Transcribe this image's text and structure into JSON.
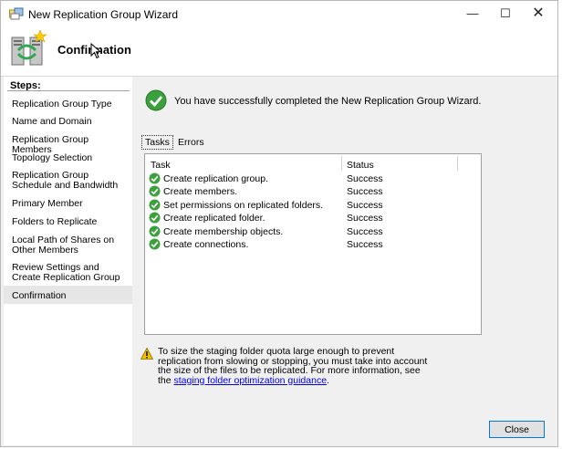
{
  "window": {
    "title": "New Replication Group Wizard",
    "controls": {
      "minimize": "—",
      "maximize": "☐",
      "close": "✕"
    }
  },
  "header": {
    "title": "Confirmation"
  },
  "steps": {
    "title": "Steps:",
    "items": [
      "Replication Group Type",
      "Name and Domain",
      "Replication Group Members",
      "Topology Selection",
      "Replication Group Schedule and Bandwidth",
      "Primary Member",
      "Folders to Replicate",
      "Local Path of Shares on Other Members",
      "Review Settings and Create Replication Group",
      "Confirmation"
    ],
    "active_index": 9
  },
  "main": {
    "success_message": "You have successfully completed the New Replication Group Wizard.",
    "tabs": {
      "tasks": "Tasks",
      "errors": "Errors"
    },
    "table": {
      "columns": {
        "task": "Task",
        "status": "Status"
      },
      "rows": [
        {
          "task": "Create replication group.",
          "status": "Success"
        },
        {
          "task": "Create members.",
          "status": "Success"
        },
        {
          "task": "Set permissions on replicated folders.",
          "status": "Success"
        },
        {
          "task": "Create replicated folder.",
          "status": "Success"
        },
        {
          "task": "Create membership objects.",
          "status": "Success"
        },
        {
          "task": "Create connections.",
          "status": "Success"
        }
      ]
    },
    "warning": {
      "text": "To size the staging folder quota large enough to prevent replication from slowing or stopping, you must take into account the size of the files to be replicated. For more information, see the ",
      "link": "staging folder optimization guidance",
      "end": "."
    },
    "close_label": "Close"
  },
  "colors": {
    "accent": "#0078d7",
    "success": "#3ca03c",
    "link": "#0000ee",
    "warning": "#f2c200"
  }
}
